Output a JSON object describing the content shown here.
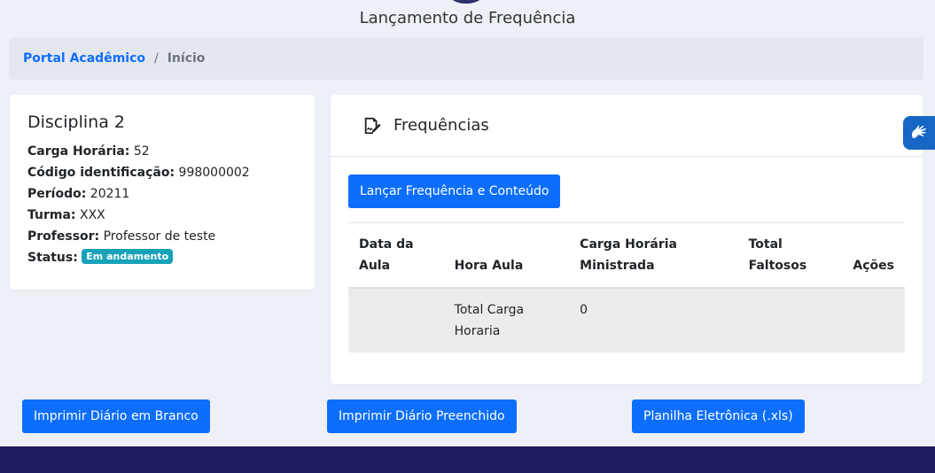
{
  "page": {
    "title": "Lançamento de Frequência"
  },
  "breadcrumb": {
    "home": "Portal Acadêmico",
    "separator": "/",
    "current": "Início"
  },
  "discipline": {
    "name": "Disciplina 2",
    "carga_label": "Carga Horária:",
    "carga_value": "52",
    "codigo_label": "Código identificação:",
    "codigo_value": "998000002",
    "periodo_label": "Período:",
    "periodo_value": "20211",
    "turma_label": "Turma:",
    "turma_value": "XXX",
    "professor_label": "Professor:",
    "professor_value": "Professor de teste",
    "status_label": "Status:",
    "status_value": "Em andamento"
  },
  "frequencias": {
    "title": "Frequências",
    "launch_button": "Lançar Frequência e Conteúdo",
    "columns": [
      "Data da Aula",
      "Hora Aula",
      "Carga Horária Ministrada",
      "Total Faltosos",
      "Ações"
    ],
    "total_row": {
      "label": "Total Carga Horaria",
      "value": "0"
    }
  },
  "actions": {
    "print_blank": "Imprimir Diário em Branco",
    "print_filled": "Imprimir Diário Preenchido",
    "spreadsheet": "Planilha Eletrônica (.xls)"
  },
  "icons": {
    "edit": "edit-signature-icon",
    "accessibility": "sign-language-icon"
  },
  "colors": {
    "primary": "#0d6efd",
    "badge": "#17a2b8",
    "footer": "#1c1c5e"
  }
}
